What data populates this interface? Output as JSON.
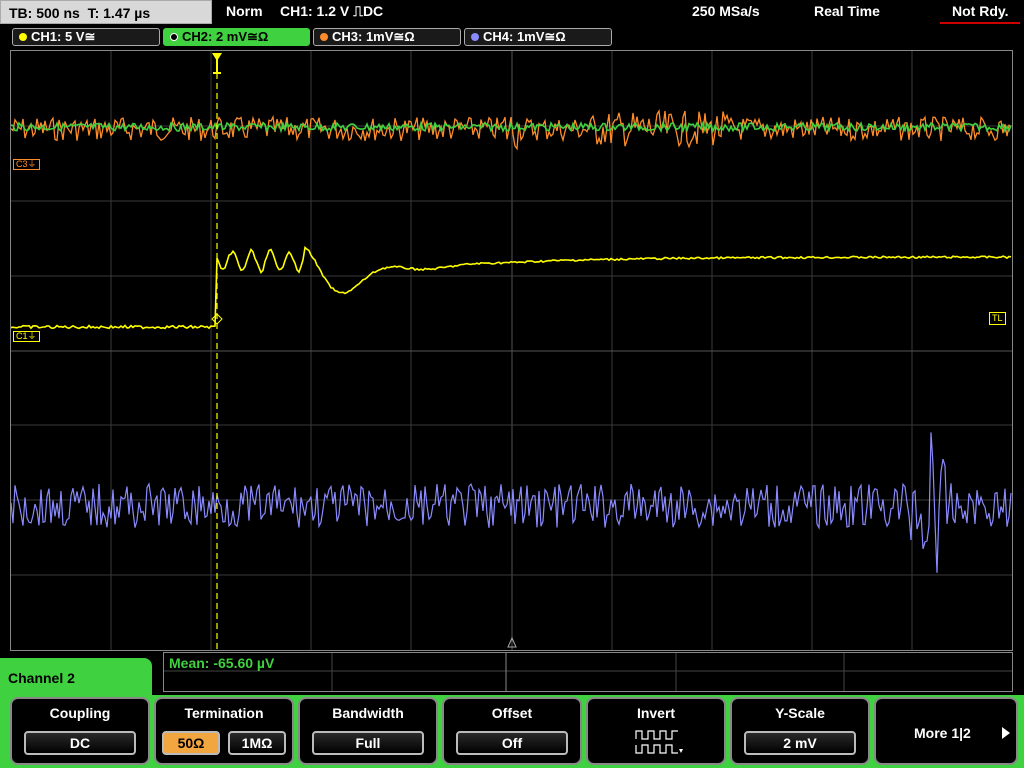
{
  "status": {
    "timebase": "TB: 500 ns",
    "trigger_time": "T: 1.47 µs",
    "mode": "Norm",
    "trigger_info": "CH1: 1.2 V ⎍DC",
    "sample_rate": "250 MSa/s",
    "acq_mode": "Real Time",
    "ready": "Not Rdy."
  },
  "channels": [
    {
      "label": "CH1: 5 V≅",
      "color": "#ffff00"
    },
    {
      "label": "CH2: 2 mV≅Ω",
      "color": "#3fd13f"
    },
    {
      "label": "CH3: 1mV≅Ω",
      "color": "#ff8c2a"
    },
    {
      "label": "CH4: 1mV≅Ω",
      "color": "#8a8aff"
    }
  ],
  "markers": {
    "c3": "C3⏚",
    "c1": "C1⏚",
    "tl": "TL"
  },
  "measurement": {
    "mean": "Mean: -65.60 µV"
  },
  "menu": {
    "title": "Channel 2",
    "softkeys": [
      {
        "title": "Coupling",
        "value": "DC"
      },
      {
        "title": "Termination",
        "value_a": "50Ω",
        "value_b": "1MΩ"
      },
      {
        "title": "Bandwidth",
        "value": "Full"
      },
      {
        "title": "Offset",
        "value": "Off"
      },
      {
        "title": "Invert",
        "icon": "inverted-square-wave-icon"
      },
      {
        "title": "Y-Scale",
        "value": "2 mV"
      },
      {
        "title": "More 1|2",
        "icon": "right-arrow-icon"
      }
    ]
  },
  "colors": {
    "accent": "#3fd13f",
    "selected_termination": "#f2a640",
    "trigger_marker": "#ffff00"
  }
}
